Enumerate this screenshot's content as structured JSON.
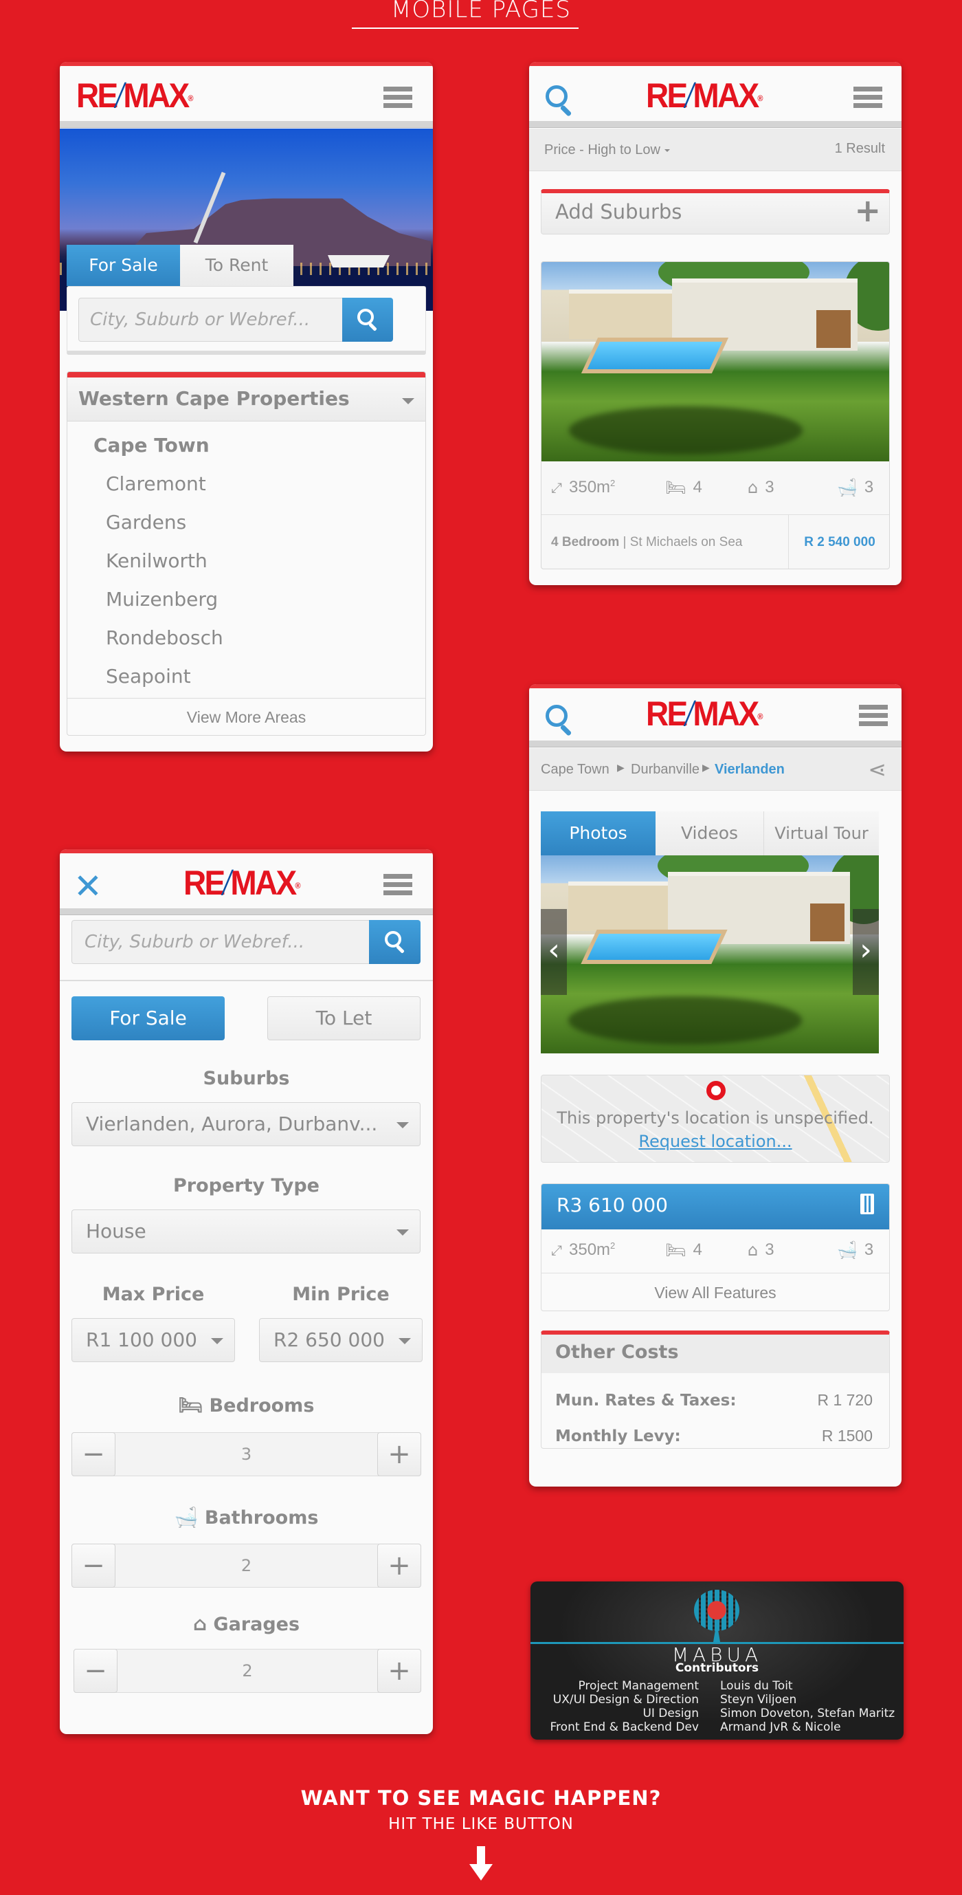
{
  "page": {
    "title": "MOBILE PAGES",
    "footer_heading": "WANT TO SEE MAGIC HAPPEN?",
    "footer_subheading": "HIT THE LIKE BUTTON",
    "footer_icon": "arrow-down-icon"
  },
  "colors": {
    "background": "#e21b23",
    "brand_red": "#e4141f",
    "brand_blue": "#0c4fa3",
    "accent_blue": "#3e97d3",
    "text_gray": "#8a8a8a",
    "panel_bg": "#fafafa",
    "dark_card": "#1e1e1e"
  },
  "brand": {
    "logo_left": "RE",
    "logo_slash": "/",
    "logo_right": "MAX",
    "logo_mark": "®"
  },
  "home_screen": {
    "menu_icon": "hamburger-icon",
    "hero_image": "Cape Town harbour at dusk with Table Mountain",
    "tabs": [
      {
        "label": "For Sale",
        "active": true
      },
      {
        "label": "To Rent",
        "active": false
      }
    ],
    "search_placeholder": "City, Suburb or Webref...",
    "search_button_icon": "search-icon",
    "region_dropdown": "Western Cape Properties",
    "city": "Cape Town",
    "suburbs": [
      "Claremont",
      "Gardens",
      "Kenilworth",
      "Muizenberg",
      "Rondebosch",
      "Seapoint"
    ],
    "view_more": "View More Areas"
  },
  "results_screen": {
    "sort": "Price - High to Low",
    "result_count": "1 Result",
    "add_suburbs": "Add Suburbs",
    "listing": {
      "size": "350m",
      "size_unit_sup": "2",
      "bedrooms": "4",
      "garages": "3",
      "bathrooms": "3",
      "title_bold": "4 Bedroom",
      "separator": "|",
      "location": "St Michaels on Sea",
      "price": "R 2 540 000"
    }
  },
  "filter_screen": {
    "close_icon": "close-icon",
    "search_placeholder": "City, Suburb or Webref...",
    "toggle": [
      {
        "label": "For Sale",
        "active": true
      },
      {
        "label": "To Let",
        "active": false
      }
    ],
    "suburbs_label": "Suburbs",
    "suburbs_value": "Vierlanden, Aurora, Durbanv...",
    "property_type_label": "Property Type",
    "property_type_value": "House",
    "max_price_label": "Max Price",
    "max_price_value": "R1 100 000",
    "min_price_label": "Min Price",
    "min_price_value": "R2 650 000",
    "bedrooms_label": "Bedrooms",
    "bedrooms_value": "3",
    "bathrooms_label": "Bathrooms",
    "bathrooms_value": "2",
    "garages_label": "Garages",
    "garages_value": "2",
    "minus": "−",
    "plus": "+"
  },
  "detail_screen": {
    "breadcrumb": [
      "Cape Town",
      "Durbanville",
      "Vierlanden"
    ],
    "share_icon": "share-icon",
    "media_tabs": [
      {
        "label": "Photos",
        "active": true
      },
      {
        "label": "Videos",
        "active": false
      },
      {
        "label": "Virtual Tour",
        "active": false
      }
    ],
    "prev_arrow": "‹",
    "next_arrow": "›",
    "location_message": "This property's location is unspecified.",
    "request_location": "Request location...",
    "price": "R3 610 000",
    "calculator_icon": "calculator-icon",
    "size": "350m",
    "size_unit_sup": "2",
    "bedrooms": "4",
    "garages": "3",
    "bathrooms": "3",
    "view_all_features": "View All Features",
    "other_costs_title": "Other Costs",
    "costs": [
      {
        "label": "Mun. Rates & Taxes:",
        "value": "R 1 720"
      },
      {
        "label": "Monthly Levy:",
        "value": "R 1500"
      }
    ]
  },
  "credits": {
    "company": "MABUA",
    "heading": "Contributors",
    "rows": [
      {
        "role": "Project Management",
        "name": "Louis du Toit"
      },
      {
        "role": "UX/UI Design & Direction",
        "name": "Steyn Viljoen"
      },
      {
        "role": "UI Design",
        "name": "Simon Doveton, Stefan Maritz"
      },
      {
        "role": "Front End & Backend Dev",
        "name": "Armand JvR & Nicole"
      }
    ]
  }
}
